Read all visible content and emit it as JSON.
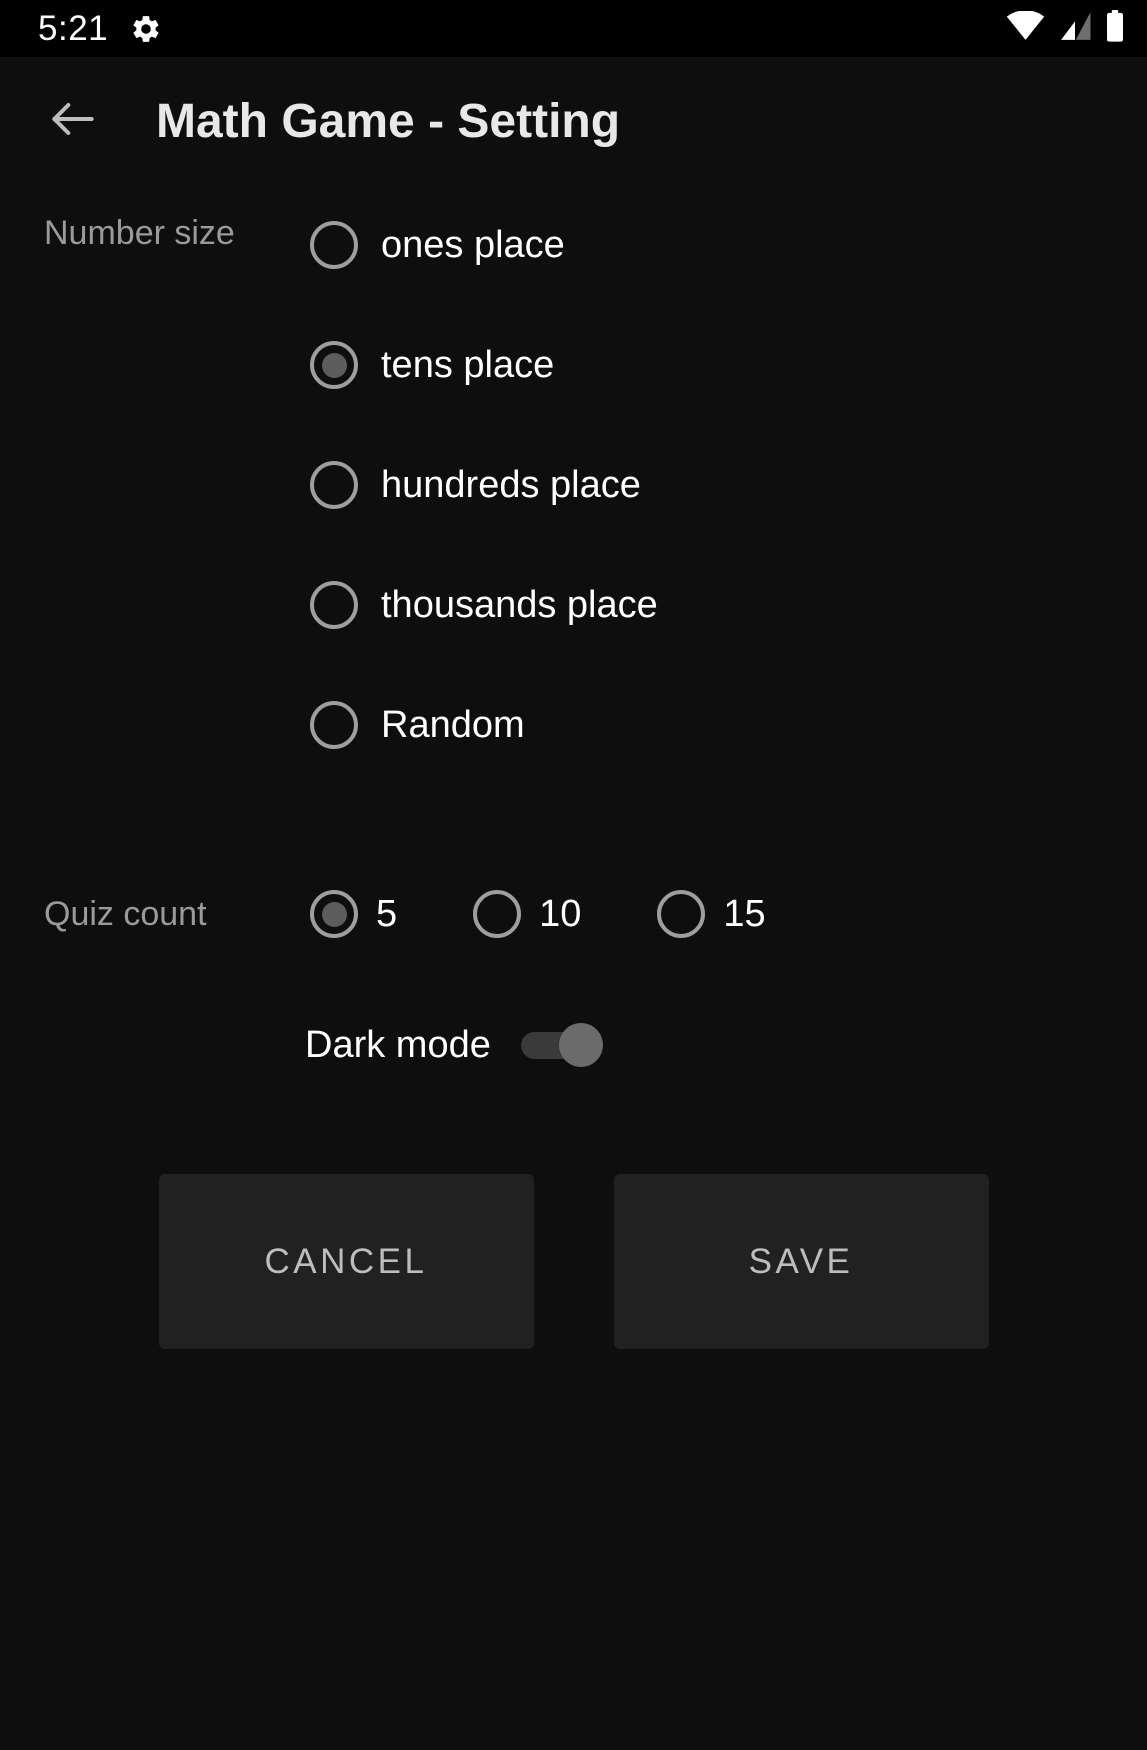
{
  "status_bar": {
    "time": "5:21",
    "icons": [
      "gear-icon",
      "wifi-icon",
      "cellular-signal-icon",
      "battery-icon"
    ]
  },
  "app_bar": {
    "back_label": "Back",
    "title": "Math Game - Setting"
  },
  "number_size": {
    "label": "Number size",
    "selected": "tens place",
    "options": [
      {
        "label": "ones place",
        "checked": false
      },
      {
        "label": "tens place",
        "checked": true
      },
      {
        "label": "hundreds place",
        "checked": false
      },
      {
        "label": "thousands place",
        "checked": false
      },
      {
        "label": "Random",
        "checked": false
      }
    ]
  },
  "quiz_count": {
    "label": "Quiz count",
    "selected": "5",
    "options": [
      {
        "label": "5",
        "checked": true
      },
      {
        "label": "10",
        "checked": false
      },
      {
        "label": "15",
        "checked": false
      }
    ]
  },
  "dark_mode": {
    "label": "Dark mode",
    "enabled": true
  },
  "actions": {
    "cancel_label": "CANCEL",
    "save_label": "SAVE"
  },
  "colors": {
    "background": "#0e0e0e",
    "status_bar_background": "#000000",
    "title_text": "#e8e8e8",
    "side_label_text": "#9a9a9a",
    "option_text": "#ffffff",
    "radio_outline": "#9e9e9e",
    "radio_dot": "#5c5c5c",
    "button_background": "#212121",
    "button_text": "#bdbdbd",
    "switch_track": "#3a3a3a",
    "switch_thumb": "#6b6b6b"
  }
}
